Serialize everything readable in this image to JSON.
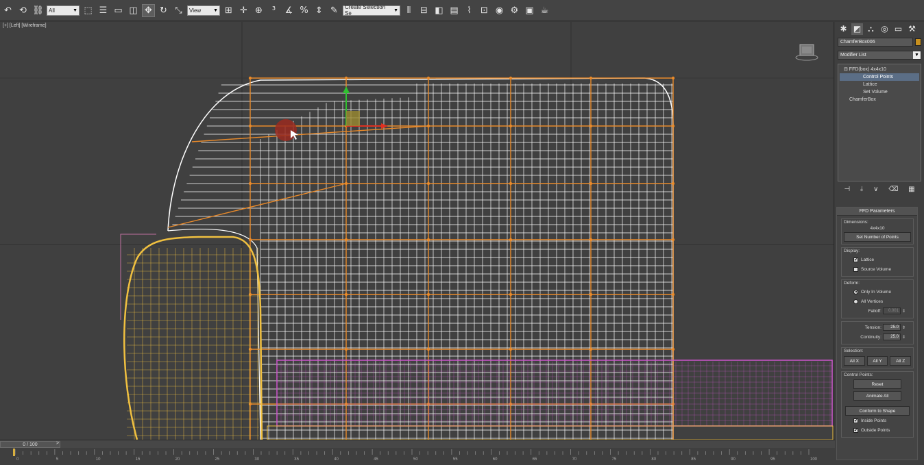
{
  "toolbar": {
    "selection_filter": "All",
    "ref_coord": "View",
    "named_selection": "Create Selection Se",
    "icons": [
      "undo-icon",
      "redo-icon",
      "link-icon",
      "selection-filter-dropdown",
      "select-object-icon",
      "select-by-name-icon",
      "rect-select-icon",
      "window-crossing-icon",
      "move-icon",
      "rotate-icon",
      "scale-icon",
      "ref-coord-dropdown",
      "pivot-icon",
      "snaps-icon",
      "angle-snap-icon",
      "percent-snap-icon",
      "spinner-snap-icon",
      "edit-named-sel-icon",
      "named-selection-dropdown",
      "mirror-icon",
      "align-icon",
      "layer-icon",
      "graphite-icon",
      "curve-editor-icon",
      "schematic-icon",
      "material-editor-icon",
      "render-setup-icon",
      "rendered-frame-icon",
      "render-icon",
      "teapot-icon"
    ]
  },
  "viewport": {
    "label": "[+] [Left] [Wireframe]",
    "wire_color": "#ffffff",
    "lattice_color": "#e98a2a",
    "cushion_color": "#f0c040",
    "base_color": "#cc55cc",
    "gizmo_x_color": "#e03020",
    "gizmo_y_color": "#30c030"
  },
  "command_panel": {
    "tabs": [
      "create-tab",
      "modify-tab",
      "hierarchy-tab",
      "motion-tab",
      "display-tab",
      "utilities-tab"
    ],
    "object_name": "ChamferBox006",
    "object_color": "#c8901e",
    "modifier_list": "Modifier List",
    "stack": [
      {
        "label": "FFD(box) 4x4x10",
        "indent": 0,
        "selected": false,
        "expanded": true
      },
      {
        "label": "Control Points",
        "indent": 1,
        "selected": true
      },
      {
        "label": "Lattice",
        "indent": 1,
        "selected": false
      },
      {
        "label": "Set Volume",
        "indent": 1,
        "selected": false
      },
      {
        "label": "ChamferBox",
        "indent": 0,
        "selected": false
      }
    ],
    "stack_tools": [
      "pin-stack-icon",
      "show-end-result-icon",
      "make-unique-icon",
      "remove-modifier-icon",
      "configure-sets-icon"
    ],
    "ffd": {
      "title": "FFD Parameters",
      "dimensions_title": "Dimensions:",
      "dimensions_value": "4x4x10",
      "set_points_label": "Set Number of Points",
      "display_title": "Display:",
      "lattice_label": "Lattice",
      "lattice_checked": true,
      "source_volume_label": "Source Volume",
      "source_volume_checked": false,
      "deform_title": "Deform:",
      "only_in_volume_label": "Only In Volume",
      "all_vertices_label": "All Vertices",
      "falloff_label": "Falloff:",
      "falloff_value": "0.001",
      "tension_label": "Tension:",
      "tension_value": "25.0",
      "continuity_label": "Continuity:",
      "continuity_value": "25.0",
      "selection_title": "Selection:",
      "all_x": "All X",
      "all_y": "All Y",
      "all_z": "All Z",
      "control_points_title": "Control Points:",
      "reset_label": "Reset",
      "animate_all_label": "Animate All",
      "conform_label": "Conform to Shape",
      "inside_points_label": "Inside Points",
      "inside_checked": true,
      "outside_points_label": "Outside Points",
      "outside_checked": true
    }
  },
  "timeline": {
    "frame_display": "0 / 100",
    "next_label": ">",
    "ticks": [
      "0",
      "5",
      "10",
      "15",
      "20",
      "25",
      "30",
      "35",
      "40",
      "45",
      "50",
      "55",
      "60",
      "65",
      "70",
      "75",
      "80",
      "85",
      "90",
      "95",
      "100"
    ]
  }
}
